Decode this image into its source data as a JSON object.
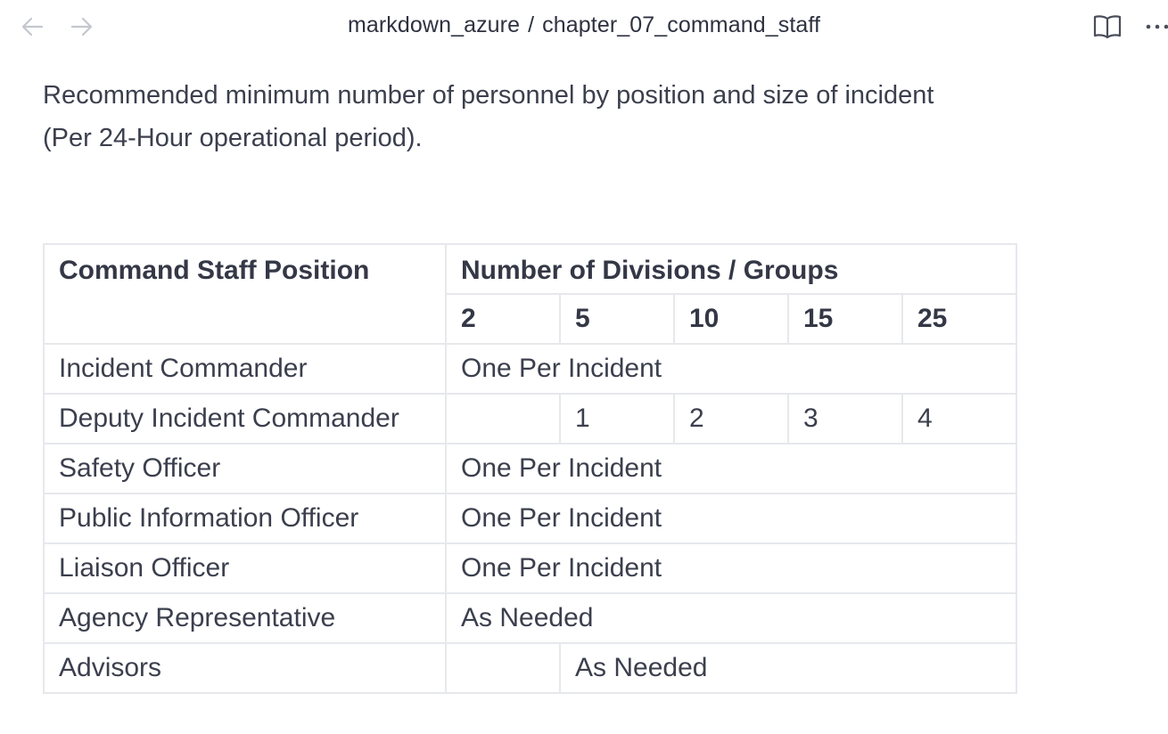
{
  "nav": {
    "back_icon": "arrow-left-icon",
    "forward_icon": "arrow-right-icon"
  },
  "breadcrumb": {
    "folder": "markdown_azure",
    "separator": "/",
    "file": "chapter_07_command_staff"
  },
  "actions": {
    "reading_view_icon": "book-open-icon",
    "more_icon": "more-options-icon"
  },
  "intro_text": "Recommended minimum number of personnel by position and size of incident (Per 24-Hour operational period).",
  "table": {
    "col_header": "Command Staff Position",
    "group_header": "Number of Divisions / Groups",
    "sizes": [
      "2",
      "5",
      "10",
      "15",
      "25"
    ],
    "rows": [
      {
        "position": "Incident Commander",
        "value": "One Per Incident"
      },
      {
        "position": "Deputy Incident Commander",
        "values": [
          "",
          "1",
          "2",
          "3",
          "4"
        ]
      },
      {
        "position": "Safety Officer",
        "value": "One Per Incident"
      },
      {
        "position": "Public Information Officer",
        "value": "One Per Incident"
      },
      {
        "position": "Liaison Officer",
        "value": "One Per Incident"
      },
      {
        "position": "Agency Representative",
        "value": "As Needed"
      },
      {
        "position": "Advisors",
        "first": "",
        "value": "As Needed"
      }
    ]
  }
}
